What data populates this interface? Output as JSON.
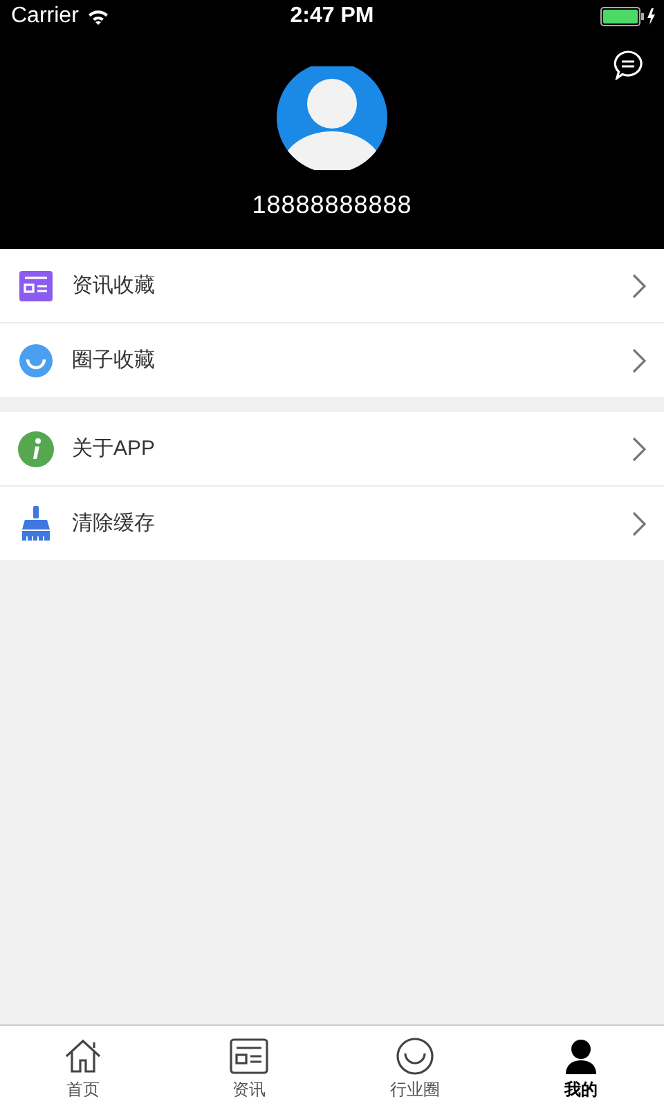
{
  "status_bar": {
    "carrier": "Carrier",
    "time": "2:47 PM"
  },
  "profile": {
    "phone": "18888888888"
  },
  "menu_groups": [
    {
      "items": [
        {
          "kind": "news",
          "label": "资讯收藏"
        },
        {
          "kind": "circle",
          "label": "圈子收藏"
        }
      ]
    },
    {
      "items": [
        {
          "kind": "info",
          "label": "关于APP"
        },
        {
          "kind": "broom",
          "label": "清除缓存"
        }
      ]
    }
  ],
  "tabs": [
    {
      "kind": "home",
      "label": "首页",
      "selected": false
    },
    {
      "kind": "news",
      "label": "资讯",
      "selected": false
    },
    {
      "kind": "circle",
      "label": "行业圈",
      "selected": false
    },
    {
      "kind": "person",
      "label": "我的",
      "selected": true
    }
  ]
}
